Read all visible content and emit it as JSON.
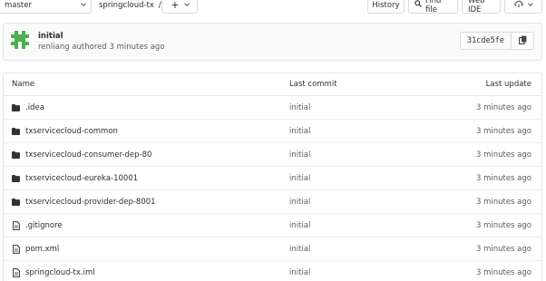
{
  "toolbar": {
    "branch": "master",
    "breadcrumb": "springcloud-tx",
    "breadcrumb_sep": "/",
    "add_symbol": "+",
    "history": "History",
    "find_file": "Find file",
    "web_ide": "Web IDE"
  },
  "commit": {
    "title": "initial",
    "meta": "renliang authored 3 minutes ago",
    "sha": "31cde5fe"
  },
  "table": {
    "headers": {
      "name": "Name",
      "last_commit": "Last commit",
      "last_update": "Last update"
    },
    "rows": [
      {
        "name": ".idea",
        "type": "folder",
        "commit": "initial",
        "updated": "3 minutes ago"
      },
      {
        "name": "txservicecloud-common",
        "type": "folder",
        "commit": "initial",
        "updated": "3 minutes ago"
      },
      {
        "name": "txservicecloud-consumer-dep-80",
        "type": "folder",
        "commit": "initial",
        "updated": "3 minutes ago"
      },
      {
        "name": "txservicecloud-eureka-10001",
        "type": "folder",
        "commit": "initial",
        "updated": "3 minutes ago"
      },
      {
        "name": "txservicecloud-provider-dep-8001",
        "type": "folder",
        "commit": "initial",
        "updated": "3 minutes ago"
      },
      {
        "name": ".gitignore",
        "type": "file",
        "commit": "initial",
        "updated": "3 minutes ago"
      },
      {
        "name": "pom.xml",
        "type": "file",
        "commit": "initial",
        "updated": "3 minutes ago"
      },
      {
        "name": "springcloud-tx.iml",
        "type": "file",
        "commit": "initial",
        "updated": "3 minutes ago"
      }
    ]
  },
  "icons": {
    "folder": "folder-icon",
    "file": "file-icon",
    "search": "search-icon",
    "copy": "copy-icon",
    "clone": "clone-icon"
  },
  "colors": {
    "avatar": "#4caf50",
    "text": "#2e2e2e",
    "muted": "#5c5c5c",
    "border": "#e5e5e5"
  }
}
